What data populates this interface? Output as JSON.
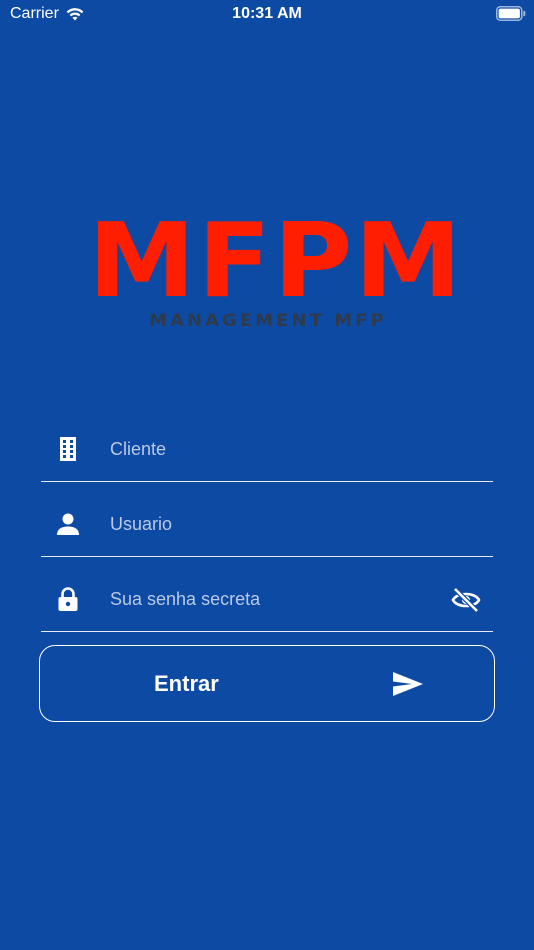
{
  "status_bar": {
    "carrier": "Carrier",
    "time": "10:31 AM",
    "icons": [
      "wifi-icon",
      "battery-icon"
    ]
  },
  "logo": {
    "main": "MFPM",
    "sub": "MANAGEMENT MFP",
    "main_color": "#ff1e00"
  },
  "form": {
    "cliente": {
      "placeholder": "Cliente",
      "value": "",
      "icon": "building-icon"
    },
    "usuario": {
      "placeholder": "Usuario",
      "value": "",
      "icon": "person-icon"
    },
    "senha": {
      "placeholder": "Sua senha secreta",
      "value": "",
      "icon": "lock-icon",
      "toggle_icon": "eye-off-icon"
    }
  },
  "submit": {
    "label": "Entrar",
    "icon": "send-icon"
  },
  "colors": {
    "background": "#0d4aa3",
    "accent": "#ff1e00",
    "text": "#ffffff",
    "placeholder": "#b9c9e6"
  }
}
